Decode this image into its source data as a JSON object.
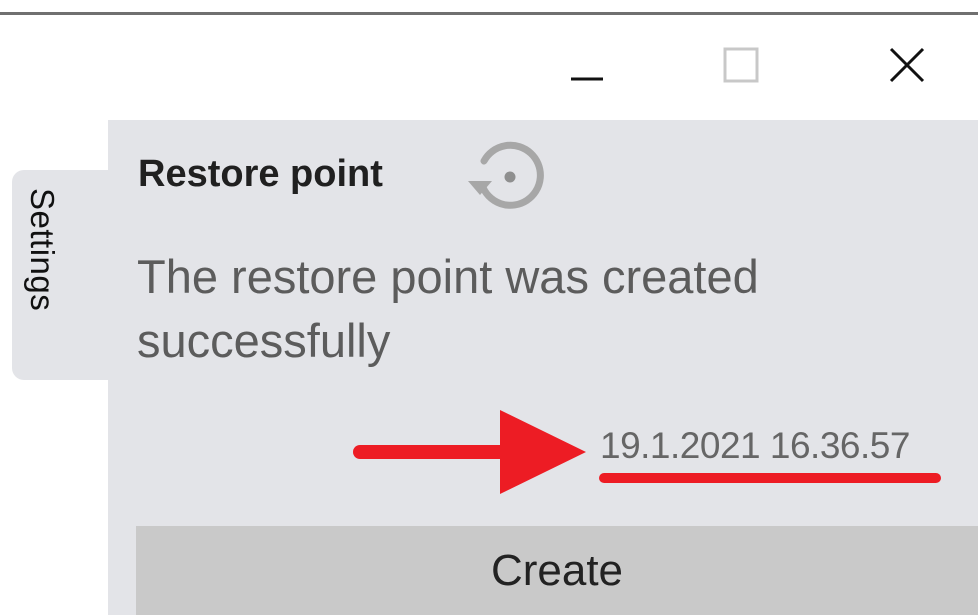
{
  "window": {
    "controls": {
      "minimize_icon": "minimize-icon",
      "maximize_icon": "maximize-icon",
      "close_icon": "close-icon"
    }
  },
  "sidebar": {
    "tab_label": "Settings"
  },
  "restore_point": {
    "title": "Restore point",
    "icon": "restore-icon",
    "message": "The restore point was created successfully",
    "timestamp": "19.1.2021 16.36.57",
    "create_button_label": "Create"
  },
  "annotation": {
    "arrow_color": "#ed1c24",
    "underline_color": "#ed1c24"
  },
  "colors": {
    "panel_background": "#e3e4e8",
    "button_background": "#c9c9c9"
  }
}
